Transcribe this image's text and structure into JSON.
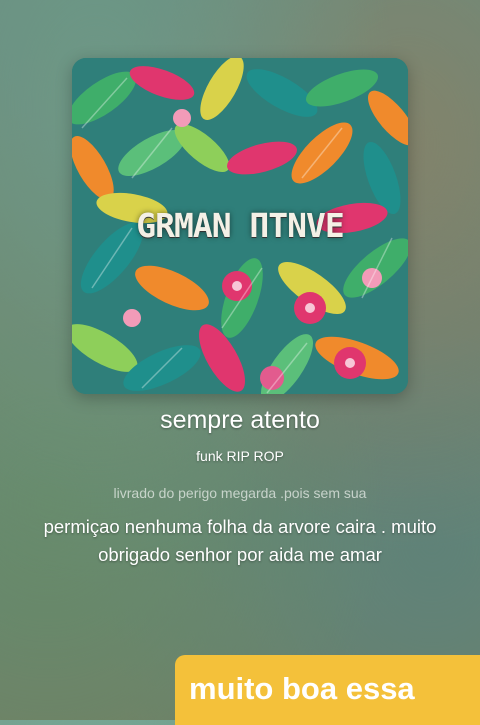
{
  "album": {
    "cover_text": "GRMAN ΠTNVE"
  },
  "track": {
    "title": "sempre atento",
    "artist": "funk  RIP ROP"
  },
  "lyrics": {
    "previous": "livrado do perigo megarda .pois sem sua",
    "current": "permiçao nenhuma folha da arvore caira . muito obrigado senhor por aida me amar"
  },
  "comment": {
    "text": "muito boa essa",
    "background": "#f4c13a"
  },
  "colors": {
    "cover_base": "#2f7f7a",
    "leaf_orange": "#f08a2c",
    "leaf_pink": "#e0366e",
    "leaf_green": "#3fae6a",
    "leaf_yellow": "#d9d24a",
    "leaf_teal": "#1f8f8c"
  }
}
